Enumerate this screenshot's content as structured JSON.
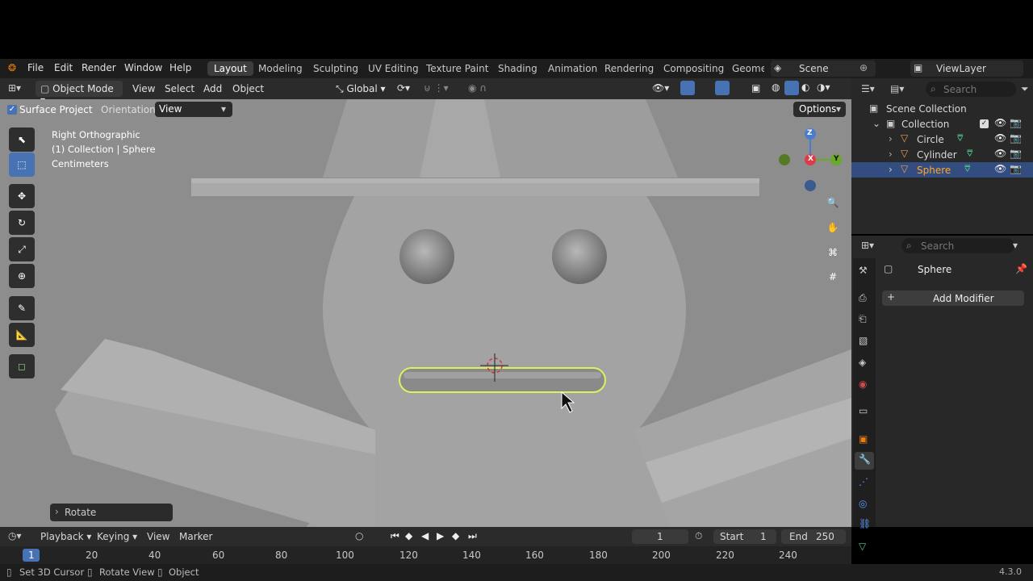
{
  "menu": {
    "file": "File",
    "edit": "Edit",
    "render": "Render",
    "window": "Window",
    "help": "Help"
  },
  "workspaces": [
    "Layout",
    "Modeling",
    "Sculpting",
    "UV Editing",
    "Texture Paint",
    "Shading",
    "Animation",
    "Rendering",
    "Compositing",
    "Geome"
  ],
  "scene": {
    "label": "Scene",
    "viewlayer": "ViewLayer"
  },
  "header": {
    "mode": "Object Mode",
    "view": "View",
    "select": "Select",
    "add": "Add",
    "object": "Object",
    "transform": "Global"
  },
  "tool_settings": {
    "surface_project": "Surface Project",
    "orientation_label": "Orientation:",
    "orientation_value": "View",
    "options": "Options"
  },
  "viewport_info": {
    "line1": "Right Orthographic",
    "line2": "(1) Collection | Sphere",
    "line3": "Centimeters"
  },
  "last_op": "Rotate",
  "gizmo": {
    "z": "Z",
    "x": "X",
    "y": "Y"
  },
  "outliner": {
    "search_placeholder": "Search",
    "scene_collection": "Scene Collection",
    "collection": "Collection",
    "objects": [
      "Circle",
      "Cylinder",
      "Sphere"
    ]
  },
  "properties": {
    "search_placeholder": "Search",
    "object_name": "Sphere",
    "add_modifier": "Add Modifier"
  },
  "timeline": {
    "playback": "Playback",
    "keying": "Keying",
    "view": "View",
    "marker": "Marker",
    "current_frame": "1",
    "start_label": "Start",
    "start": "1",
    "end_label": "End",
    "end": "250",
    "ticks": [
      "20",
      "40",
      "60",
      "80",
      "100",
      "120",
      "140",
      "160",
      "180",
      "200",
      "220",
      "240"
    ],
    "playhead": "1"
  },
  "status": {
    "a": "Set 3D Cursor",
    "b": "Rotate View",
    "c": "Object",
    "version": "4.3.0"
  },
  "colors": {
    "accent": "#4772b3",
    "selected_outline": "#e0f060",
    "active_object": "#ffa726"
  }
}
